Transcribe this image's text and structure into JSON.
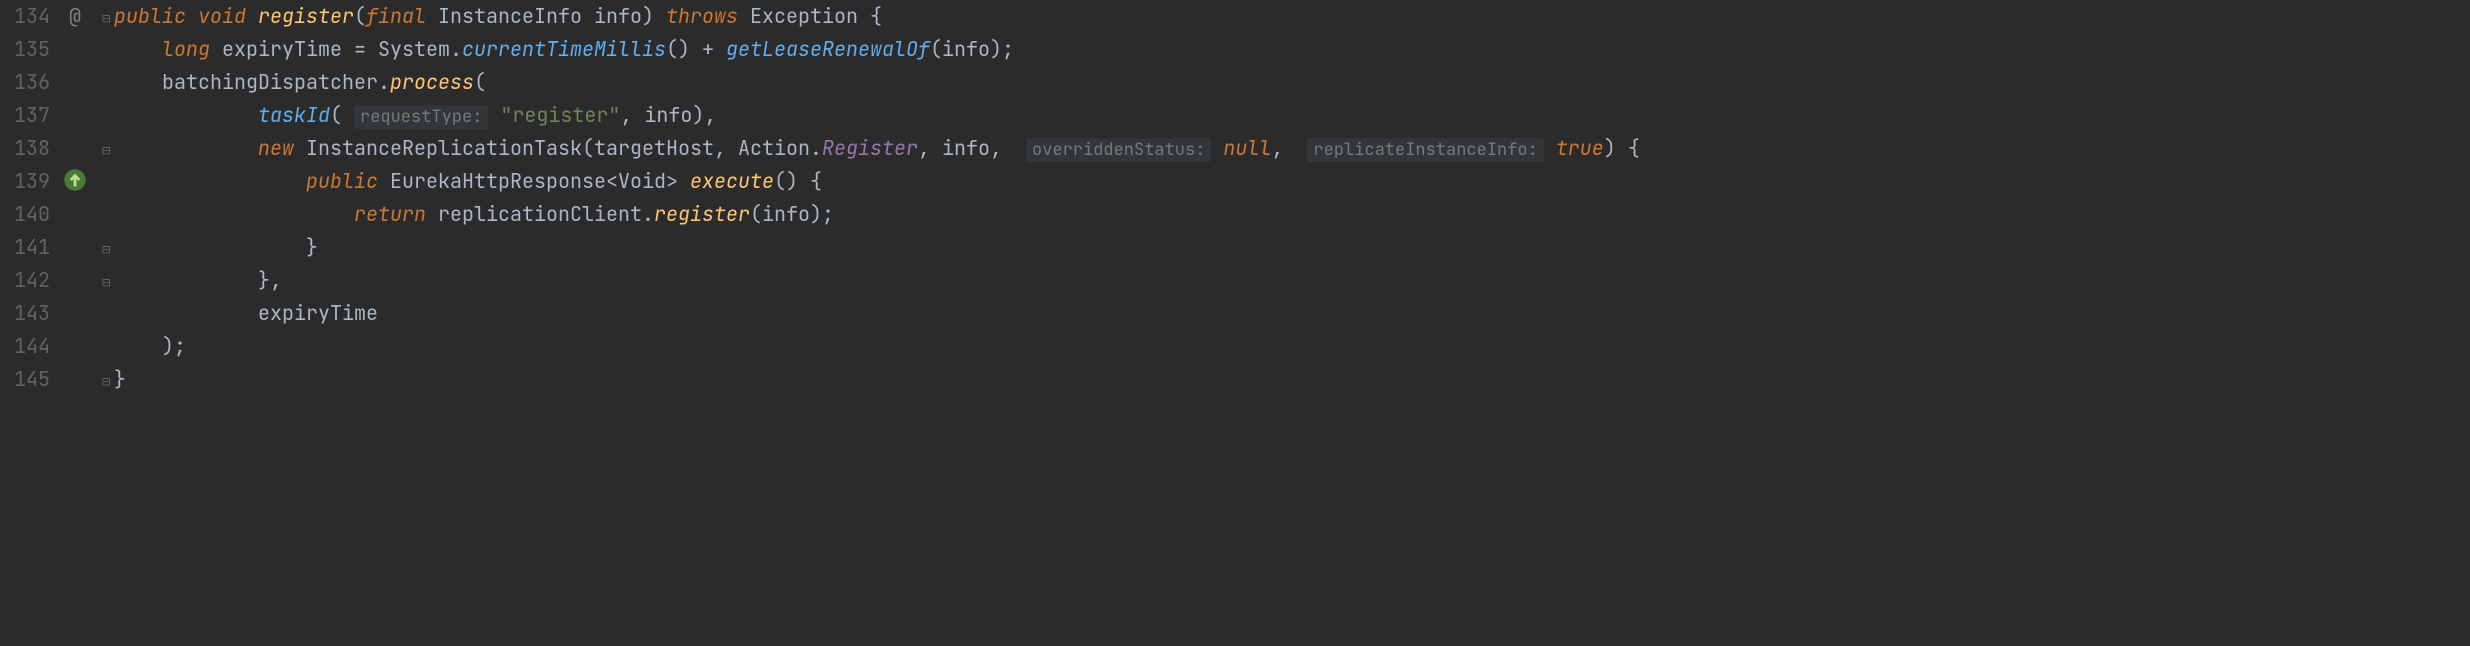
{
  "gutter": {
    "lines": [
      "134",
      "135",
      "136",
      "137",
      "138",
      "139",
      "140",
      "141",
      "142",
      "143",
      "144",
      "145"
    ],
    "at_sign": "@",
    "override_marker": "fx"
  },
  "code": {
    "kw_public": "public",
    "kw_void": "void",
    "kw_final": "final",
    "kw_long": "long",
    "kw_new": "new",
    "kw_return": "return",
    "kw_throws": "throws",
    "kw_null": "null",
    "kw_true": "true",
    "method_register": "register",
    "type_InstanceInfo": "InstanceInfo",
    "var_info": "info",
    "type_Exception": "Exception",
    "var_expiryTime": "expiryTime",
    "class_System": "System",
    "method_currentTimeMillis": "currentTimeMillis",
    "method_getLeaseRenewalOf": "getLeaseRenewalOf",
    "var_batchingDispatcher": "batchingDispatcher",
    "method_process": "process",
    "method_taskId": "taskId",
    "hint_requestType": "requestType:",
    "str_register": "\"register\"",
    "type_InstanceReplicationTask": "InstanceReplicationTask",
    "var_targetHost": "targetHost",
    "class_Action": "Action",
    "enum_Register": "Register",
    "hint_overriddenStatus": "overriddenStatus:",
    "hint_replicateInstanceInfo": "replicateInstanceInfo:",
    "type_EurekaHttpResponse": "EurekaHttpResponse",
    "type_Void": "Void",
    "method_execute": "execute",
    "var_replicationClient": "replicationClient"
  }
}
